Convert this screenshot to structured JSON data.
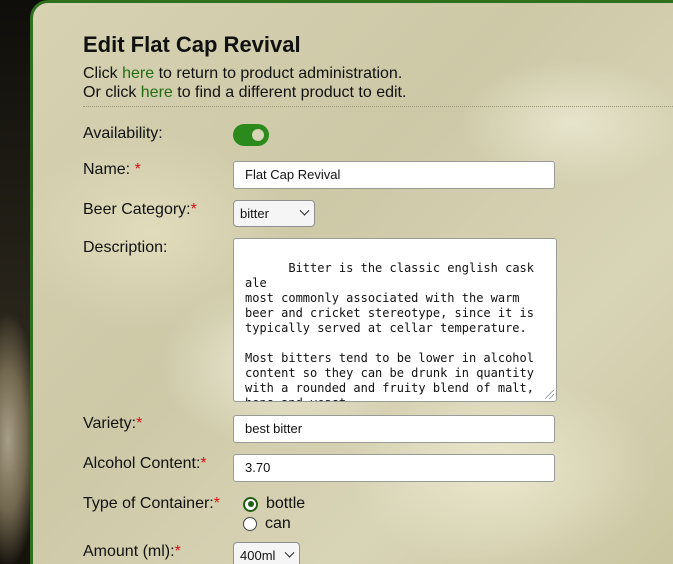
{
  "page": {
    "title": "Edit Flat Cap Revival",
    "intro_line1_pre": "Click ",
    "intro_line1_link": "here",
    "intro_line1_post": " to return to product administration.",
    "intro_line2_pre": "Or click ",
    "intro_line2_link": "here",
    "intro_line2_post": " to find a different product to edit."
  },
  "form": {
    "availability": {
      "label": "Availability:",
      "enabled": true
    },
    "name": {
      "label": "Name: ",
      "required_mark": "*",
      "value": "Flat Cap Revival"
    },
    "category": {
      "label": "Beer Category:",
      "required_mark": "*",
      "selected": "bitter"
    },
    "description": {
      "label": "Description:",
      "value": "Bitter is the classic english cask ale\nmost commonly associated with the warm\nbeer and cricket stereotype, since it is\ntypically served at cellar temperature.\n\nMost bitters tend to be lower in alcohol\ncontent so they can be drunk in quantity\nwith a rounded and fruity blend of malt,\nhops and yeast\n\nBitters go well with light, wealthier"
    },
    "variety": {
      "label": "Variety:",
      "required_mark": "*",
      "value": "best bitter"
    },
    "alcohol": {
      "label": "Alcohol Content:",
      "required_mark": "*",
      "value": "3.70"
    },
    "container": {
      "label": "Type of Container:",
      "required_mark": "*",
      "options": [
        "bottle",
        "can"
      ],
      "selected": "bottle"
    },
    "amount": {
      "label": "Amount (ml):",
      "required_mark": "*",
      "selected": "400ml"
    }
  },
  "colors": {
    "accent_green": "#2b8a1c",
    "link_green": "#236b13",
    "required_red": "#dd1111"
  }
}
